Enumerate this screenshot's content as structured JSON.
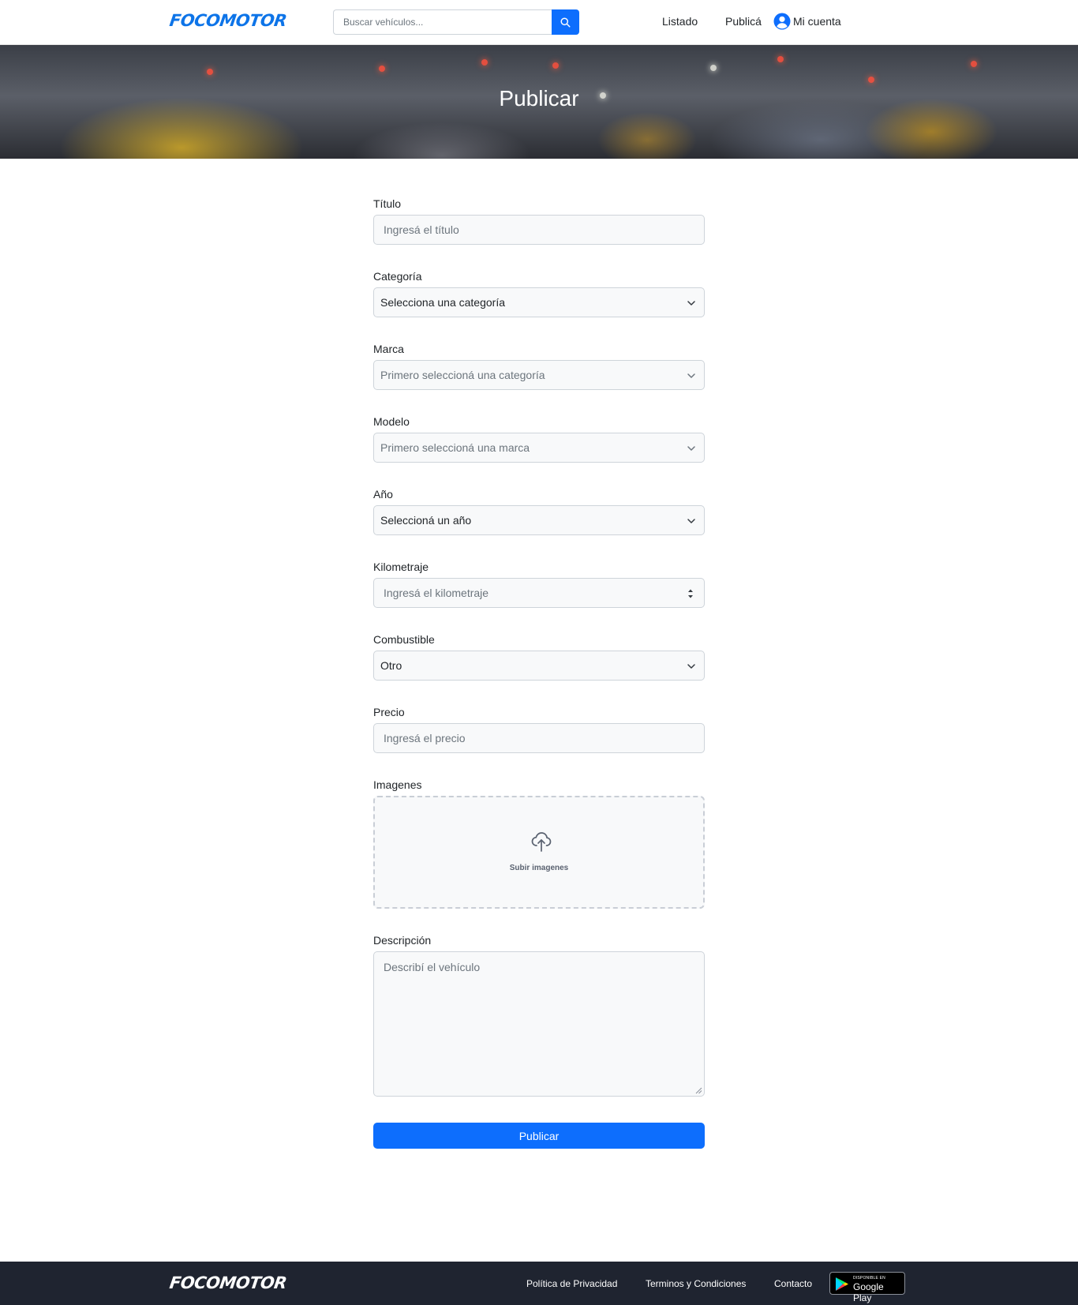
{
  "header": {
    "logo": "FOCOMOTOR",
    "search_placeholder": "Buscar vehículos...",
    "nav": {
      "listado": "Listado",
      "publica": "Publicá",
      "account": "Mi cuenta"
    }
  },
  "hero": {
    "title": "Publicar"
  },
  "form": {
    "titulo": {
      "label": "Título",
      "placeholder": "Ingresá el título"
    },
    "categoria": {
      "label": "Categoría",
      "value": "Selecciona una categoría"
    },
    "marca": {
      "label": "Marca",
      "value": "Primero seleccioná una categoría"
    },
    "modelo": {
      "label": "Modelo",
      "value": "Primero seleccioná una marca"
    },
    "anio": {
      "label": "Año",
      "value": "Seleccioná un año"
    },
    "kilometraje": {
      "label": "Kilometraje",
      "placeholder": "Ingresá el kilometraje"
    },
    "combustible": {
      "label": "Combustible",
      "value": "Otro"
    },
    "precio": {
      "label": "Precio",
      "placeholder": "Ingresá el precio"
    },
    "imagenes": {
      "label": "Imagenes",
      "upload_label": "Subir imagenes"
    },
    "descripcion": {
      "label": "Descripción",
      "placeholder": "Describí el vehículo"
    },
    "submit": "Publicar"
  },
  "footer": {
    "logo": "FOCOMOTOR",
    "links": [
      "Política de Privacidad",
      "Terminos y Condiciones",
      "Contacto"
    ],
    "store_badge": {
      "small": "DISPONIBLE EN",
      "big": "Google Play"
    }
  },
  "colors": {
    "primary": "#0d6efd",
    "footer_bg": "#1f2430",
    "logo": "#0d74e8"
  }
}
